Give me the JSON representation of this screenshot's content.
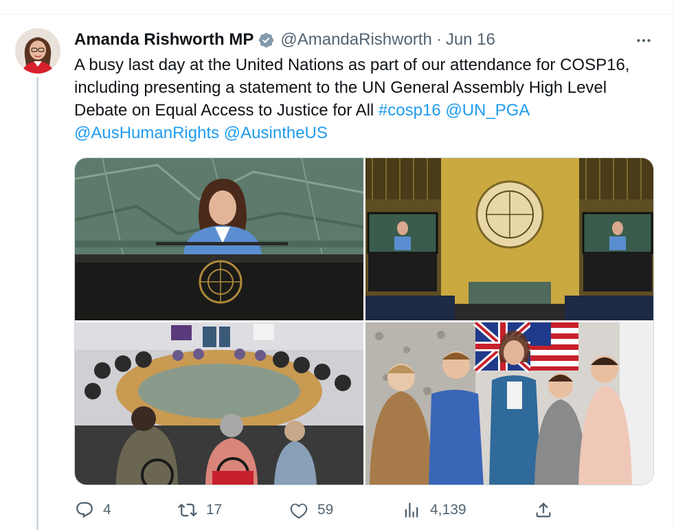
{
  "author": {
    "name": "Amanda Rishworth MP",
    "handle": "@AmandaRishworth",
    "separator": "·",
    "date": "Jun 16",
    "verified": true
  },
  "tweet": {
    "text": "A busy last day at the United Nations as part of our attendance for COSP16, including presenting a statement to the UN General Assembly High Level Debate on Equal Access to Justice for All",
    "links": [
      "#cosp16",
      "@UN_PGA",
      "@AusHumanRights",
      "@AusintheUS"
    ]
  },
  "media": [
    {
      "icon": "photo-speaker-at-un-podium"
    },
    {
      "icon": "photo-un-general-assembly-hall"
    },
    {
      "icon": "photo-roundtable-meeting"
    },
    {
      "icon": "photo-group-with-flags"
    }
  ],
  "actions": {
    "reply_count": "4",
    "retweet_count": "17",
    "like_count": "59",
    "views_count": "4,139"
  },
  "colors": {
    "link": "#1d9bf0",
    "verified": "#829aab",
    "muted": "#536471",
    "text": "#0f1419"
  }
}
